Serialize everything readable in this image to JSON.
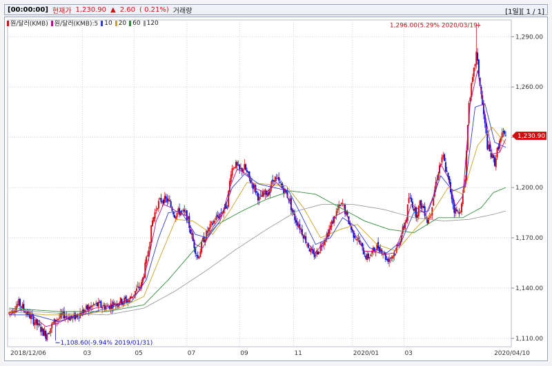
{
  "header": {
    "time": "[00:00:00]",
    "price_label": "현재가",
    "price": "1,230.90",
    "change_arrow": "▲",
    "change": "2.60",
    "change_pct": "( 0.21%)",
    "volume_label": "거래량",
    "page_info": "[1일][ 1 / 1]"
  },
  "legend": {
    "series1": "원/달러(KMB)",
    "series2": "원/달러(KMB):5",
    "ma10": "10",
    "ma20": "20",
    "ma60": "60",
    "ma120": "120"
  },
  "colors": {
    "up": "#d01010",
    "down": "#1010c8",
    "ma5": "#b01090",
    "ma10": "#2a3cd0",
    "ma20": "#c8a020",
    "ma60": "#2e8a3a",
    "ma120": "#9a9a9a",
    "price_tag": "#d01010"
  },
  "chart_data": {
    "type": "candlestick",
    "y_ticks": [
      "1,290.00",
      "1,260.00",
      "1,230.00",
      "1,200.00",
      "1,170.00",
      "1,140.00",
      "1,110.00"
    ],
    "x_labels": [
      "2018/12/06",
      "03",
      "05",
      "07",
      "09",
      "11",
      "2020/01",
      "03",
      "2020/04/10"
    ],
    "ylim": [
      1105,
      1300
    ],
    "current_price": "1,230.90",
    "annotations": {
      "high": "1,296.00(5.29% 2020/03/19)",
      "low": "1,108.60(-9.94% 2019/01/31)"
    },
    "price_path": [
      [
        0,
        1125
      ],
      [
        8,
        1131
      ],
      [
        15,
        1125
      ],
      [
        22,
        1119
      ],
      [
        30,
        1112
      ],
      [
        38,
        1121
      ],
      [
        45,
        1124
      ],
      [
        52,
        1122
      ],
      [
        60,
        1126
      ],
      [
        70,
        1130
      ],
      [
        80,
        1129
      ],
      [
        90,
        1132
      ],
      [
        98,
        1133
      ],
      [
        103,
        1138
      ],
      [
        108,
        1142
      ],
      [
        113,
        1160
      ],
      [
        117,
        1180
      ],
      [
        121,
        1190
      ],
      [
        125,
        1193
      ],
      [
        130,
        1192
      ],
      [
        135,
        1184
      ],
      [
        140,
        1186
      ],
      [
        145,
        1183
      ],
      [
        150,
        1168
      ],
      [
        154,
        1158
      ],
      [
        158,
        1168
      ],
      [
        163,
        1175
      ],
      [
        168,
        1181
      ],
      [
        173,
        1185
      ],
      [
        178,
        1190
      ],
      [
        181,
        1210
      ],
      [
        184,
        1214
      ],
      [
        188,
        1210
      ],
      [
        192,
        1212
      ],
      [
        196,
        1205
      ],
      [
        200,
        1200
      ],
      [
        204,
        1193
      ],
      [
        208,
        1196
      ],
      [
        212,
        1198
      ],
      [
        216,
        1206
      ],
      [
        220,
        1203
      ],
      [
        224,
        1199
      ],
      [
        228,
        1194
      ],
      [
        232,
        1183
      ],
      [
        236,
        1178
      ],
      [
        240,
        1172
      ],
      [
        244,
        1165
      ],
      [
        248,
        1159
      ],
      [
        252,
        1162
      ],
      [
        256,
        1168
      ],
      [
        260,
        1173
      ],
      [
        264,
        1180
      ],
      [
        268,
        1187
      ],
      [
        272,
        1190
      ],
      [
        276,
        1182
      ],
      [
        280,
        1173
      ],
      [
        284,
        1170
      ],
      [
        288,
        1163
      ],
      [
        292,
        1158
      ],
      [
        296,
        1161
      ],
      [
        300,
        1165
      ],
      [
        304,
        1163
      ],
      [
        308,
        1157
      ],
      [
        312,
        1159
      ],
      [
        316,
        1163
      ],
      [
        320,
        1172
      ],
      [
        324,
        1182
      ],
      [
        326,
        1194
      ],
      [
        329,
        1190
      ],
      [
        332,
        1184
      ],
      [
        335,
        1190
      ],
      [
        338,
        1188
      ],
      [
        341,
        1180
      ],
      [
        344,
        1186
      ],
      [
        348,
        1203
      ],
      [
        351,
        1213
      ],
      [
        354,
        1218
      ],
      [
        357,
        1208
      ],
      [
        360,
        1198
      ],
      [
        363,
        1187
      ],
      [
        366,
        1185
      ],
      [
        369,
        1189
      ],
      [
        372,
        1207
      ],
      [
        375,
        1252
      ],
      [
        378,
        1264
      ],
      [
        381,
        1280
      ],
      [
        384,
        1261
      ],
      [
        387,
        1243
      ],
      [
        390,
        1225
      ],
      [
        393,
        1219
      ],
      [
        396,
        1215
      ],
      [
        399,
        1225
      ],
      [
        402,
        1231
      ],
      [
        405,
        1230.9
      ]
    ],
    "ma5_path": [
      [
        0,
        1124
      ],
      [
        10,
        1127
      ],
      [
        20,
        1123
      ],
      [
        30,
        1117
      ],
      [
        40,
        1119
      ],
      [
        50,
        1123
      ],
      [
        60,
        1125
      ],
      [
        70,
        1128
      ],
      [
        80,
        1129
      ],
      [
        90,
        1131
      ],
      [
        100,
        1134
      ],
      [
        108,
        1140
      ],
      [
        114,
        1158
      ],
      [
        120,
        1180
      ],
      [
        126,
        1190
      ],
      [
        132,
        1188
      ],
      [
        138,
        1185
      ],
      [
        145,
        1183
      ],
      [
        152,
        1166
      ],
      [
        158,
        1164
      ],
      [
        166,
        1176
      ],
      [
        174,
        1184
      ],
      [
        180,
        1200
      ],
      [
        186,
        1211
      ],
      [
        194,
        1208
      ],
      [
        202,
        1199
      ],
      [
        210,
        1197
      ],
      [
        218,
        1203
      ],
      [
        226,
        1197
      ],
      [
        234,
        1181
      ],
      [
        242,
        1168
      ],
      [
        250,
        1161
      ],
      [
        258,
        1169
      ],
      [
        266,
        1183
      ],
      [
        274,
        1186
      ],
      [
        282,
        1172
      ],
      [
        290,
        1162
      ],
      [
        298,
        1162
      ],
      [
        306,
        1160
      ],
      [
        314,
        1161
      ],
      [
        322,
        1176
      ],
      [
        328,
        1190
      ],
      [
        334,
        1187
      ],
      [
        340,
        1184
      ],
      [
        346,
        1195
      ],
      [
        352,
        1214
      ],
      [
        358,
        1206
      ],
      [
        364,
        1189
      ],
      [
        370,
        1195
      ],
      [
        376,
        1250
      ],
      [
        382,
        1270
      ],
      [
        388,
        1244
      ],
      [
        394,
        1220
      ],
      [
        400,
        1221
      ],
      [
        405,
        1229
      ]
    ],
    "ma10_path": [
      [
        0,
        1124
      ],
      [
        20,
        1124
      ],
      [
        40,
        1120
      ],
      [
        60,
        1124
      ],
      [
        80,
        1128
      ],
      [
        100,
        1132
      ],
      [
        112,
        1145
      ],
      [
        122,
        1170
      ],
      [
        130,
        1185
      ],
      [
        140,
        1186
      ],
      [
        152,
        1172
      ],
      [
        162,
        1170
      ],
      [
        172,
        1180
      ],
      [
        182,
        1200
      ],
      [
        192,
        1208
      ],
      [
        204,
        1202
      ],
      [
        216,
        1200
      ],
      [
        228,
        1198
      ],
      [
        238,
        1184
      ],
      [
        250,
        1166
      ],
      [
        262,
        1170
      ],
      [
        272,
        1182
      ],
      [
        282,
        1177
      ],
      [
        294,
        1164
      ],
      [
        308,
        1161
      ],
      [
        320,
        1168
      ],
      [
        330,
        1185
      ],
      [
        342,
        1186
      ],
      [
        352,
        1207
      ],
      [
        362,
        1198
      ],
      [
        372,
        1201
      ],
      [
        380,
        1248
      ],
      [
        388,
        1250
      ],
      [
        396,
        1227
      ],
      [
        405,
        1224
      ]
    ],
    "ma20_path": [
      [
        0,
        1126
      ],
      [
        30,
        1124
      ],
      [
        60,
        1124
      ],
      [
        90,
        1128
      ],
      [
        110,
        1135
      ],
      [
        124,
        1160
      ],
      [
        136,
        1181
      ],
      [
        150,
        1180
      ],
      [
        166,
        1172
      ],
      [
        180,
        1186
      ],
      [
        194,
        1203
      ],
      [
        210,
        1202
      ],
      [
        226,
        1201
      ],
      [
        240,
        1188
      ],
      [
        254,
        1170
      ],
      [
        270,
        1175
      ],
      [
        284,
        1178
      ],
      [
        300,
        1166
      ],
      [
        316,
        1162
      ],
      [
        332,
        1176
      ],
      [
        346,
        1186
      ],
      [
        358,
        1200
      ],
      [
        370,
        1196
      ],
      [
        382,
        1225
      ],
      [
        394,
        1236
      ],
      [
        405,
        1226
      ]
    ],
    "ma60_path": [
      [
        0,
        1128
      ],
      [
        40,
        1126
      ],
      [
        80,
        1126
      ],
      [
        110,
        1130
      ],
      [
        130,
        1145
      ],
      [
        150,
        1162
      ],
      [
        170,
        1178
      ],
      [
        190,
        1186
      ],
      [
        210,
        1193
      ],
      [
        230,
        1198
      ],
      [
        250,
        1196
      ],
      [
        270,
        1188
      ],
      [
        290,
        1180
      ],
      [
        310,
        1175
      ],
      [
        330,
        1173
      ],
      [
        350,
        1182
      ],
      [
        370,
        1182
      ],
      [
        385,
        1188
      ],
      [
        395,
        1197
      ],
      [
        405,
        1200
      ]
    ],
    "ma120_path": [
      [
        0,
        1127
      ],
      [
        40,
        1125
      ],
      [
        80,
        1124
      ],
      [
        110,
        1128
      ],
      [
        135,
        1138
      ],
      [
        160,
        1150
      ],
      [
        185,
        1163
      ],
      [
        210,
        1175
      ],
      [
        235,
        1186
      ],
      [
        255,
        1190
      ],
      [
        280,
        1190
      ],
      [
        305,
        1187
      ],
      [
        330,
        1182
      ],
      [
        355,
        1180
      ],
      [
        375,
        1181
      ],
      [
        395,
        1184
      ],
      [
        405,
        1186
      ]
    ]
  }
}
